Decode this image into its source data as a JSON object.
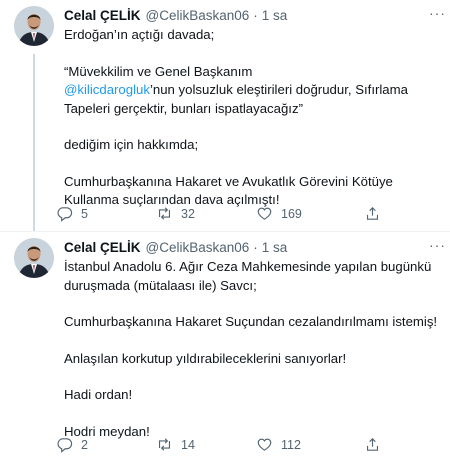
{
  "tweets": [
    {
      "name": "Celal ÇELİK",
      "handle": "@CelikBaskan06",
      "dot": "·",
      "time": "1 sa",
      "more": "···",
      "lines": [
        "Erdoğan’ın açtığı davada;",
        "",
        "“Müvekkilim ve Genel Başkanım",
        {
          "mention": "@kilicdarogluk",
          "rest": "’nun yolsuzluk eleştirileri doğrudur, Sıfırlama"
        },
        "Tapeleri gerçektir, bunları ispatlayacağız”",
        "",
        "dediğim için hakkımda;",
        "",
        "Cumhurbaşkanına Hakaret ve Avukatlık Görevini Kötüye",
        "Kullanma suçlarından dava açılmıştı!"
      ],
      "replies": "5",
      "retweets": "32",
      "likes": "169"
    },
    {
      "name": "Celal ÇELİK",
      "handle": "@CelikBaskan06",
      "dot": "·",
      "time": "1 sa",
      "more": "···",
      "lines": [
        "İstanbul Anadolu 6. Ağır Ceza Mahkemesinde yapılan bugünkü",
        "duruşmada (mütalaası ile) Savcı;",
        "",
        "Cumhurbaşkanına Hakaret Suçundan cezalandırılmamı istemiş!",
        "",
        "Anlaşılan korkutup yıldırabileceklerini sanıyorlar!",
        "",
        "Hadi ordan!",
        "",
        "Hodri meydan!"
      ],
      "replies": "2",
      "retweets": "14",
      "likes": "112"
    }
  ],
  "icons": {
    "reply": "reply-icon",
    "retweet": "retweet-icon",
    "like": "heart-icon",
    "share": "share-icon",
    "more": "more-icon"
  },
  "colors": {
    "link": "#1d9bf0",
    "secondary_text": "#536471",
    "primary_text": "#0f1419"
  }
}
